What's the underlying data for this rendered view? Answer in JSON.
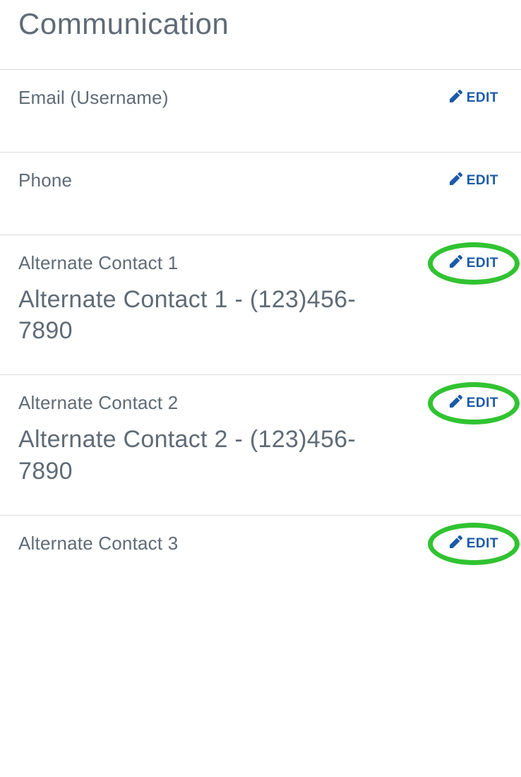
{
  "title": "Communication",
  "editLabel": "EDIT",
  "sections": [
    {
      "label": "Email (Username)",
      "value": "",
      "highlight": false
    },
    {
      "label": "Phone",
      "value": "",
      "highlight": false
    },
    {
      "label": "Alternate Contact 1",
      "value": "Alternate Contact 1 - (123)456-7890",
      "highlight": true
    },
    {
      "label": "Alternate Contact 2",
      "value": "Alternate Contact 2 - (123)456-7890",
      "highlight": true
    },
    {
      "label": "Alternate Contact 3",
      "value": "",
      "highlight": true
    }
  ]
}
